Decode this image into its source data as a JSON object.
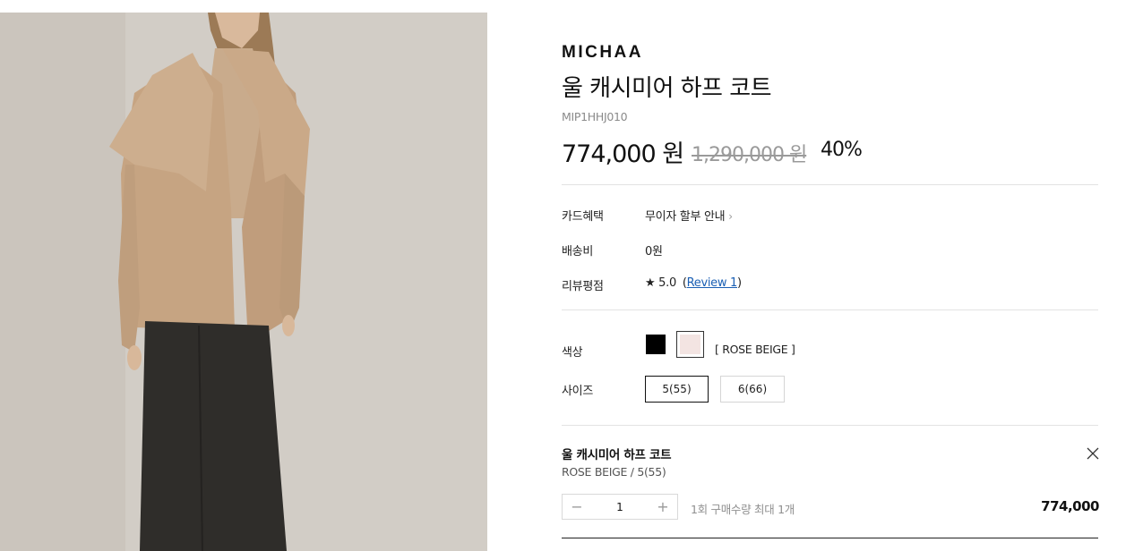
{
  "product": {
    "brand": "MICHAA",
    "name": "울 캐시미어 하프 코트",
    "code": "MIP1HHJ010",
    "price": "774,000 원",
    "original_price": "1,290,000 원",
    "discount": "40%"
  },
  "info_rows": {
    "card_label": "카드혜택",
    "card_value": "무이자 할부 안내",
    "shipping_label": "배송비",
    "shipping_value": "0원",
    "review_label": "리뷰평점",
    "review_score": "★ 5.0",
    "review_open": "(",
    "review_link": "Review 1",
    "review_close": ")"
  },
  "options": {
    "color_label": "색상",
    "colors": [
      {
        "name": "BLACK",
        "hex": "#000000"
      },
      {
        "name": "ROSE BEIGE",
        "hex": "#f3e4e2"
      }
    ],
    "selected_color_text": "[ ROSE BEIGE ]",
    "size_label": "사이즈",
    "sizes": [
      "5(55)",
      "6(66)"
    ],
    "selected_size": "5(55)"
  },
  "selected_option": {
    "title": "울 캐시미어 하프 코트",
    "subtitle": "ROSE BEIGE / 5(55)",
    "quantity": "1",
    "minus": "−",
    "plus": "+",
    "limit_note": "1회 구매수량 최대 1개",
    "price": "774,000"
  },
  "icons": [
    "chevron-right-icon",
    "close-icon",
    "minus-icon",
    "plus-icon",
    "star-icon"
  ]
}
